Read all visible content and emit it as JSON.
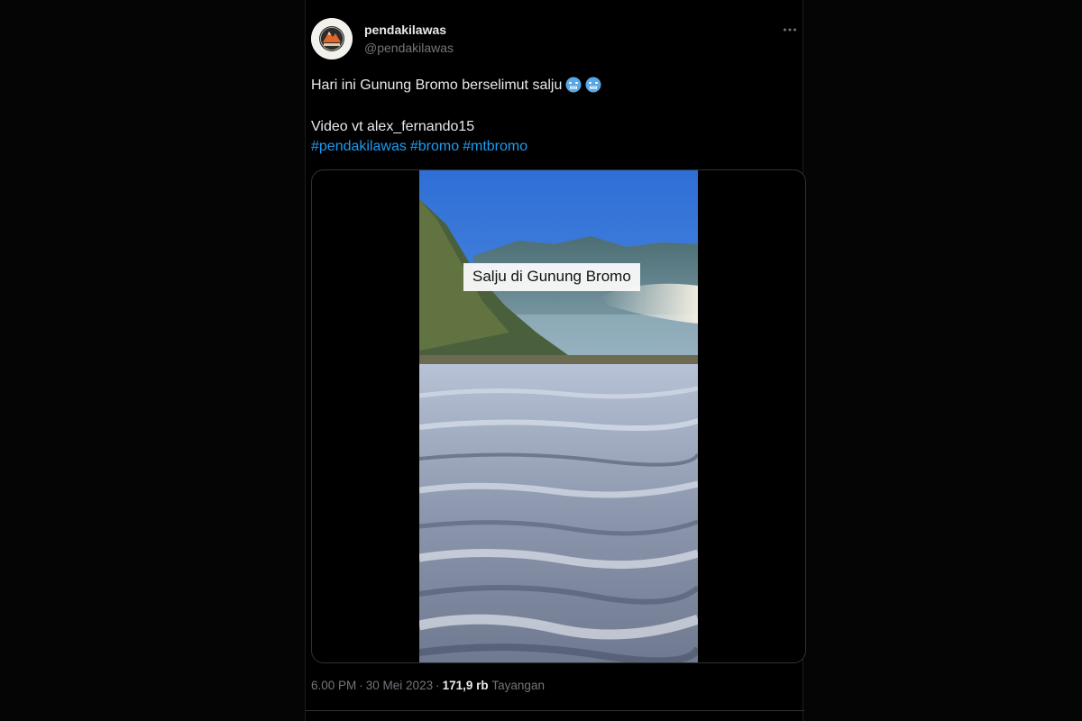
{
  "author": {
    "display_name": "pendakilawas",
    "handle": "@pendakilawas",
    "avatar_icon": "mountain-logo-icon"
  },
  "menu": {
    "more_icon": "more-horizontal-icon"
  },
  "tweet": {
    "line1": "Hari ini Gunung Bromo berselimut salju",
    "emoji_icon": "cold-face-emoji-icon",
    "line2": "Video vt alex_fernando15",
    "hashtags": [
      "#pendakilawas",
      "#bromo",
      "#mtbromo"
    ]
  },
  "media": {
    "caption": "Salju di Gunung Bromo"
  },
  "meta": {
    "time": "6.00 PM",
    "separator": "·",
    "date": "30 Mei 2023",
    "views_count": "171,9 rb",
    "views_label": "Tayangan"
  },
  "colors": {
    "background": "#000000",
    "text_primary": "#e7e9ea",
    "text_secondary": "#71767b",
    "link": "#1d9bf0",
    "border": "#2f3336"
  }
}
